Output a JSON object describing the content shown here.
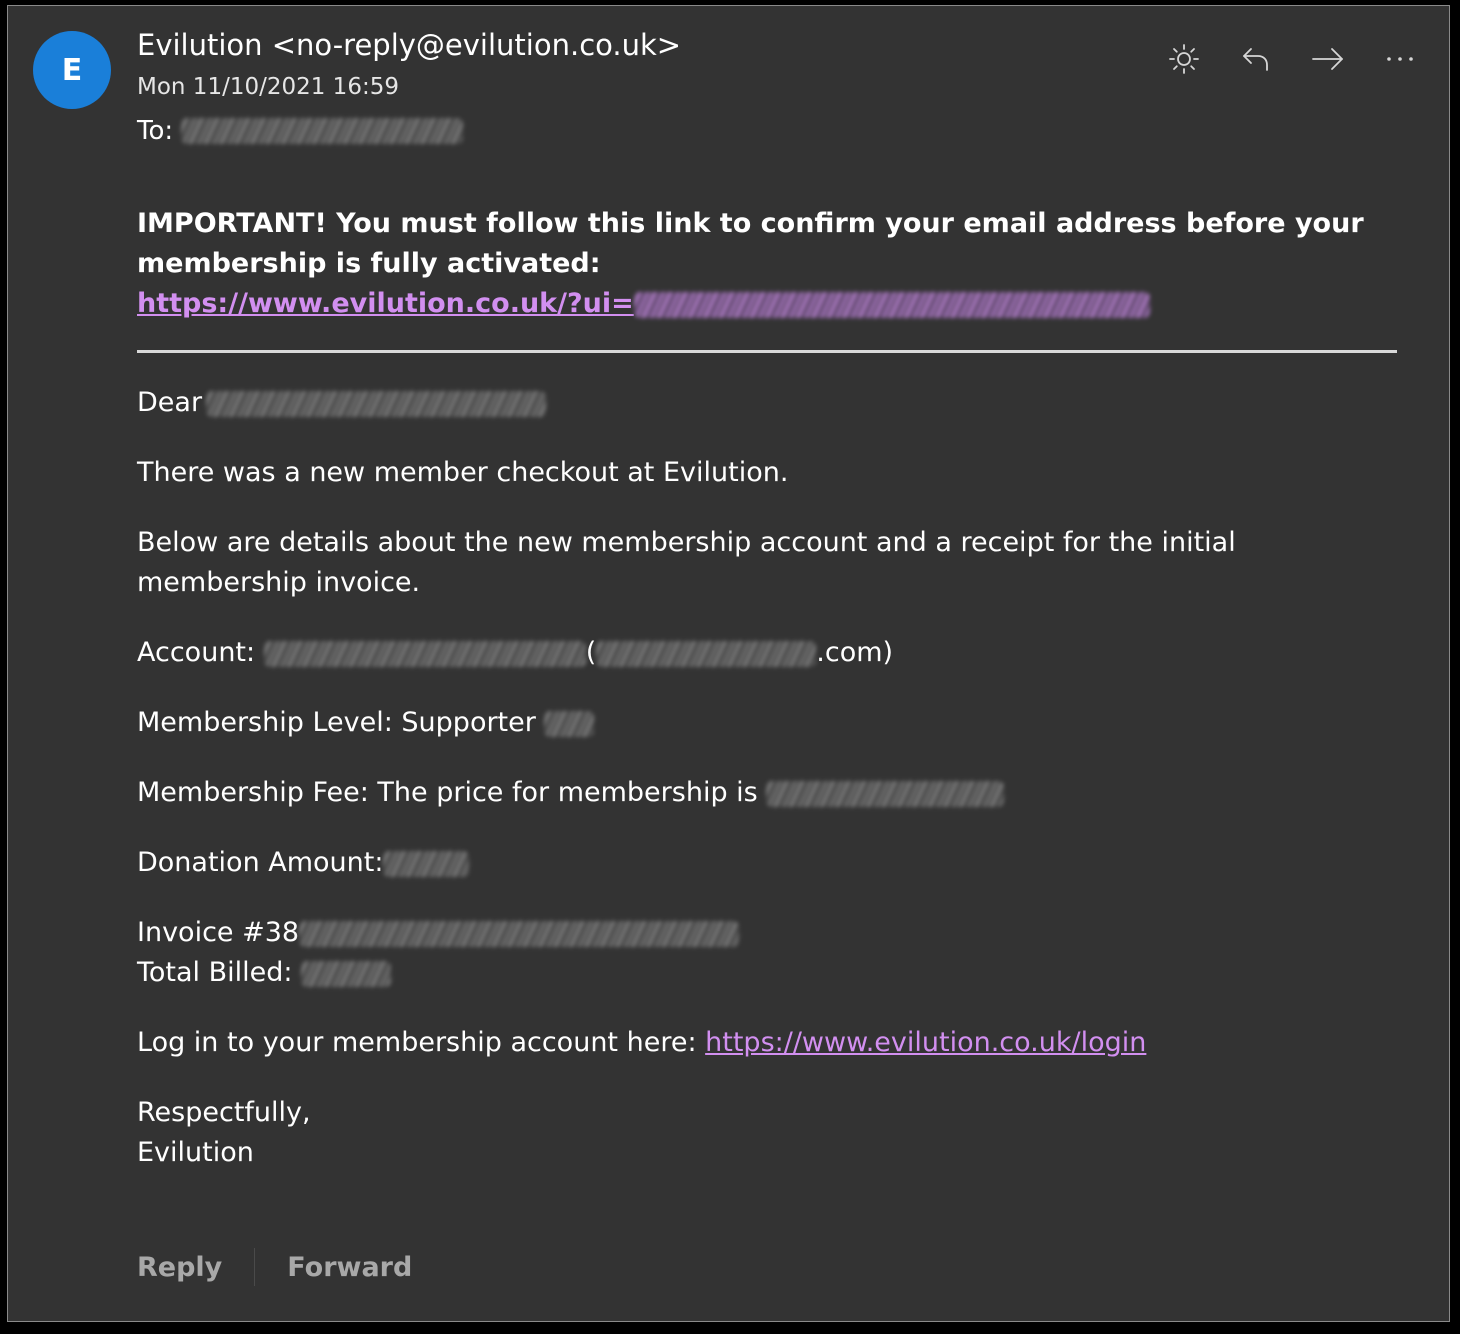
{
  "header": {
    "avatar_letter": "E",
    "sender": "Evilution <no-reply@evilution.co.uk>",
    "date": "Mon 11/10/2021 16:59",
    "to_label": "To:"
  },
  "toolbar": {
    "icons": [
      "brightness-icon",
      "reply-icon",
      "forward-icon",
      "more-icon"
    ]
  },
  "body": {
    "important_text": "IMPORTANT! You must follow this link to confirm your email address before your membership is fully activated:",
    "confirm_link_prefix": "https://www.evilution.co.uk/?ui=",
    "dear": "Dear",
    "line_checkout": "There was a new member checkout at Evilution.",
    "line_details": "Below are details about the new membership account and a receipt for the initial membership invoice.",
    "account_label": "Account:",
    "account_paren_open": "(",
    "account_email_suffix": ".com)",
    "membership_level": "Membership Level: Supporter",
    "membership_fee": "Membership Fee: The price for membership is",
    "donation_amount": "Donation Amount:",
    "invoice": "Invoice #38",
    "total_billed": "Total Billed:",
    "login_text": "Log in to your membership account here:",
    "login_link": "https://www.evilution.co.uk/login",
    "sign_off": "Respectfully,",
    "signature": "Evilution"
  },
  "footer": {
    "reply": "Reply",
    "forward": "Forward"
  },
  "colors": {
    "background": "#333333",
    "avatar": "#1a7fd9",
    "link": "#d28ff0"
  }
}
